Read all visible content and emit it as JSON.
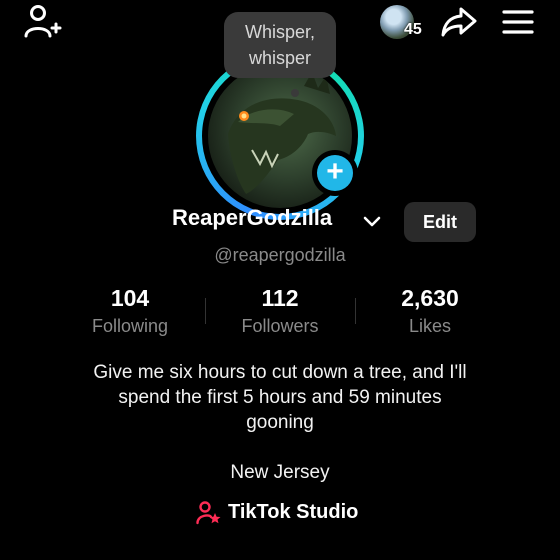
{
  "top_bar": {
    "add_friend_icon": "person-add-icon",
    "profile_visitors_count": "45",
    "share_icon": "share-icon",
    "menu_icon": "hamburger-menu-icon"
  },
  "note": {
    "text": "Whisper, whisper"
  },
  "profile": {
    "username": "ReaperGodzilla",
    "handle": "@reapergodzilla",
    "edit_label": "Edit",
    "ring_colors": [
      "#2f8cff",
      "#22d0e8",
      "#10e0a6"
    ]
  },
  "stats": {
    "following": {
      "value": "104",
      "label": "Following"
    },
    "followers": {
      "value": "112",
      "label": "Followers"
    },
    "likes": {
      "value": "2,630",
      "label": "Likes"
    }
  },
  "bio": {
    "line1": "Give me six hours to cut down a tree, and I'll",
    "line2": "spend the first 5 hours and 59 minutes",
    "line3": "gooning",
    "location": "New Jersey"
  },
  "studio": {
    "label": "TikTok Studio",
    "icon_color": "#fe2c55"
  }
}
